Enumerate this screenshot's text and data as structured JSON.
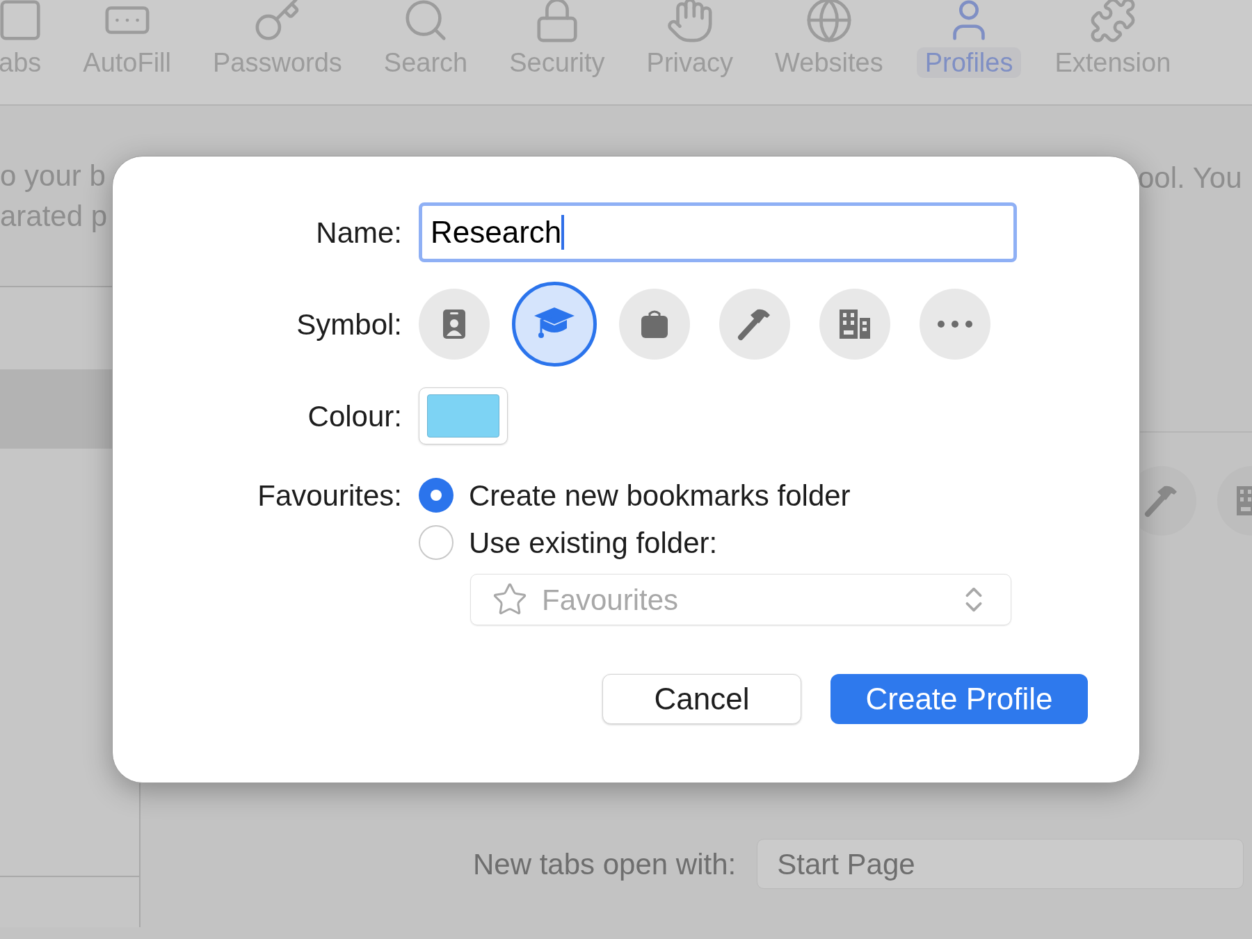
{
  "toolbar": {
    "tabs": [
      {
        "label": "abs",
        "kind": "square",
        "selected": false
      },
      {
        "label": "AutoFill",
        "kind": "form",
        "selected": false
      },
      {
        "label": "Passwords",
        "kind": "key",
        "selected": false
      },
      {
        "label": "Search",
        "kind": "search",
        "selected": false
      },
      {
        "label": "Security",
        "kind": "lock",
        "selected": false
      },
      {
        "label": "Privacy",
        "kind": "hand",
        "selected": false
      },
      {
        "label": "Websites",
        "kind": "globe",
        "selected": false
      },
      {
        "label": "Profiles",
        "kind": "person",
        "selected": true
      },
      {
        "label": "Extension",
        "kind": "puzzle",
        "selected": false
      }
    ]
  },
  "background": {
    "description_left": [
      "o your b",
      "arated p"
    ],
    "description_right": "ool. You",
    "settings": [
      {
        "label": "New tabs open with:",
        "value": "Start Page"
      }
    ]
  },
  "dialog": {
    "name": {
      "label": "Name:",
      "value": "Research"
    },
    "symbol": {
      "label": "Symbol:",
      "options": [
        {
          "kind": "badge",
          "selected": false
        },
        {
          "kind": "cap",
          "selected": true
        },
        {
          "kind": "bag",
          "selected": false
        },
        {
          "kind": "hammer",
          "selected": false
        },
        {
          "kind": "building",
          "selected": false
        },
        {
          "kind": "more",
          "selected": false
        }
      ]
    },
    "colour": {
      "label": "Colour:",
      "color": "#7dd3f4"
    },
    "favourites": {
      "label": "Favourites:",
      "options": [
        {
          "label": "Create new bookmarks folder",
          "selected": true
        },
        {
          "label": "Use existing folder:",
          "selected": false
        }
      ],
      "folder": {
        "value": "Favourites",
        "disabled": true
      }
    },
    "buttons": [
      {
        "label": "Cancel",
        "kind": "secondary"
      },
      {
        "label": "Create Profile",
        "kind": "primary"
      }
    ]
  }
}
